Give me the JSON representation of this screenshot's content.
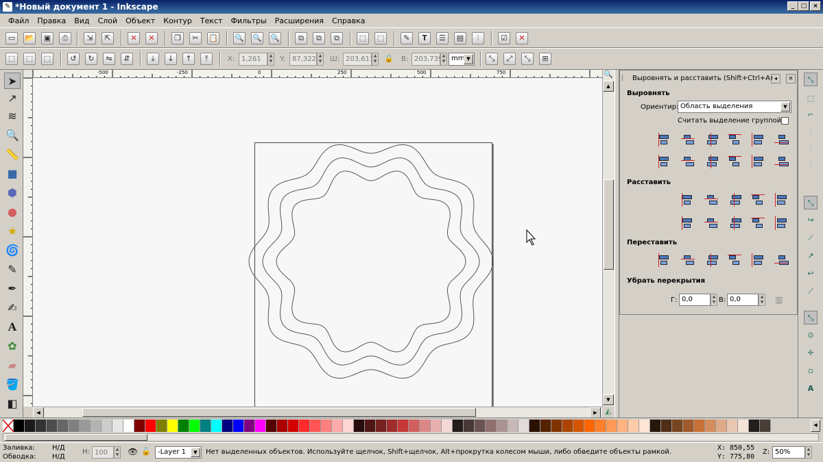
{
  "window": {
    "title": "*Новый документ 1 - Inkscape"
  },
  "menu": [
    "Файл",
    "Правка",
    "Вид",
    "Слой",
    "Объект",
    "Контур",
    "Текст",
    "Фильтры",
    "Расширения",
    "Справка"
  ],
  "toolbar2": {
    "x_label": "X:",
    "x_value": "1,261",
    "y_label": "Y:",
    "y_value": "87,322",
    "w_label": "Ш:",
    "w_value": "203,611",
    "h_label": "В:",
    "h_value": "203,739",
    "unit": "mm"
  },
  "ruler": {
    "labels": [
      "-500",
      "-250",
      "0",
      "250",
      "500",
      "750"
    ]
  },
  "dock": {
    "title": "Выровнять и расставить (Shift+Ctrl+A)",
    "align_heading": "Выровнять",
    "relative_label": "Ориентир:",
    "relative_value": "Область выделения",
    "group_label": "Считать выделение группой:",
    "distribute_heading": "Расставить",
    "rearrange_heading": "Переставить",
    "overlap_heading": "Убрать перекрытия",
    "h_label": "Г:",
    "h_value": "0,0",
    "v_label": "В:",
    "v_value": "0,0"
  },
  "palette": {
    "colors": [
      "#000000",
      "#1a1a1a",
      "#333333",
      "#4d4d4d",
      "#666666",
      "#808080",
      "#999999",
      "#b3b3b3",
      "#cccccc",
      "#e6e6e6",
      "#ffffff",
      "#800000",
      "#ff0000",
      "#808000",
      "#ffff00",
      "#008000",
      "#00ff00",
      "#008080",
      "#00ffff",
      "#000080",
      "#0000ff",
      "#800080",
      "#ff00ff",
      "#550000",
      "#aa0000",
      "#d40000",
      "#ff2a2a",
      "#ff5555",
      "#ff8080",
      "#ffaaaa",
      "#ffd5d5",
      "#280b0b",
      "#501616",
      "#782121",
      "#a02c2c",
      "#c83737",
      "#d35f5f",
      "#de8787",
      "#e9afaf",
      "#f4d7d7",
      "#241c1c",
      "#483737",
      "#6c5353",
      "#916f6f",
      "#ac9393",
      "#c8b7b7",
      "#e3dbdb",
      "#2b1100",
      "#552200",
      "#803300",
      "#aa4400",
      "#d45500",
      "#ff6600",
      "#ff7f2a",
      "#ff9955",
      "#ffb380",
      "#ffccaa",
      "#ffe6d5",
      "#28170b",
      "#502d16",
      "#784421",
      "#a05a2c",
      "#c87137",
      "#d38d5f",
      "#deaa87",
      "#e9c6af",
      "#f4e3d7",
      "#241f1c",
      "#483e37"
    ]
  },
  "status": {
    "fill_label": "Заливка:",
    "fill_value": "Н/Д",
    "stroke_label": "Обводка:",
    "stroke_value": "Н/Д",
    "opacity_label": "Н:",
    "opacity_value": "100",
    "layer": "-Layer 1",
    "message": "Нет выделенных объектов. Используйте щелчок, Shift+щелчок, Alt+прокрутка колесом мыши, либо обведите объекты рамкой.",
    "x_label": "X:",
    "x_value": "850,55",
    "y_label": "Y:",
    "y_value": "775,80",
    "zoom_label": "Z:",
    "zoom_value": "50%"
  }
}
